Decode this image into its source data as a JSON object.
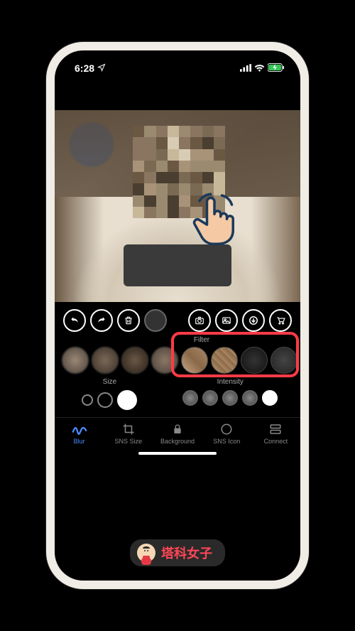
{
  "status_bar": {
    "time": "6:28",
    "location_icon": "location",
    "signal_icon": "signal",
    "wifi_icon": "wifi",
    "battery_icon": "battery-charging"
  },
  "toolbar": {
    "left_actions": [
      "undo",
      "redo",
      "delete",
      "brush-preview"
    ],
    "right_actions": [
      "camera",
      "gallery",
      "download",
      "cart"
    ]
  },
  "sections": {
    "filter_label": "Filter",
    "size_label": "Size",
    "intensity_label": "Intensity"
  },
  "tabs": {
    "blur": "Blur",
    "sns_size": "SNS Size",
    "background": "Background",
    "sns_icon": "SNS Icon",
    "connect": "Connect"
  },
  "branding": {
    "text": "塔科女子"
  },
  "highlight": {
    "color": "#ff3b47"
  }
}
